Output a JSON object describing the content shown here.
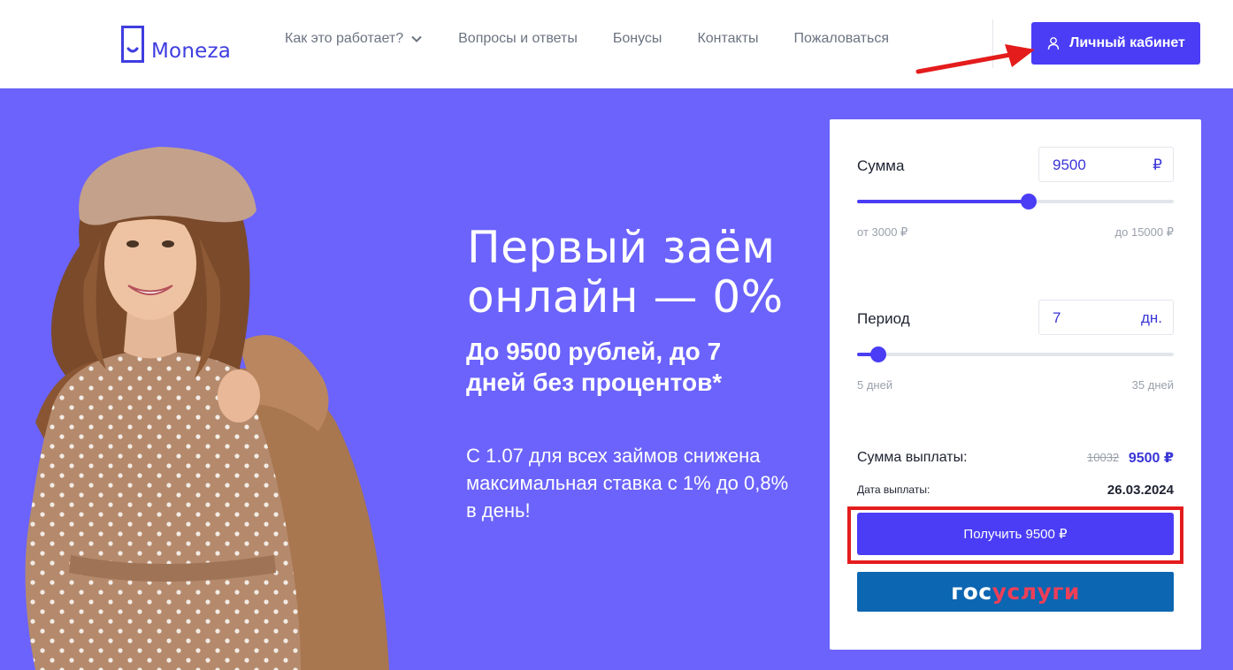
{
  "header": {
    "logo_text": "Moneza",
    "nav": [
      {
        "label": "Как это работает?",
        "has_dropdown": true
      },
      {
        "label": "Вопросы и ответы"
      },
      {
        "label": "Бонусы"
      },
      {
        "label": "Контакты"
      },
      {
        "label": "Пожаловаться"
      }
    ],
    "cabinet_label": "Личный кабинет"
  },
  "hero": {
    "title": "Первый заём онлайн — 0%",
    "subtitle": "До 9500 рублей, до 7 дней без процентов*",
    "note": "С 1.07 для всех займов снижена максимальная ставка с 1% до 0,8% в день!"
  },
  "calculator": {
    "amount": {
      "label": "Сумма",
      "value": "9500",
      "unit": "₽",
      "min_label": "от 3000 ₽",
      "max_label": "до 15000 ₽",
      "min": 3000,
      "max": 15000,
      "current": 9500
    },
    "period": {
      "label": "Период",
      "value": "7",
      "unit": "дн.",
      "min_label": "5 дней",
      "max_label": "35 дней",
      "min": 5,
      "max": 35,
      "current": 7
    },
    "payment_label": "Сумма выплаты:",
    "payment_old": "10032",
    "payment_new": "9500 ₽",
    "date_label": "Дата выплаты:",
    "date_value": "26.03.2024",
    "get_button": "Получить 9500 ₽",
    "gosuslugi_part1": "гос",
    "gosuslugi_part2": "услуги"
  },
  "colors": {
    "accent": "#4a3df5",
    "hero_bg": "#6b63fb",
    "gosuslugi_blue": "#0c66b1",
    "gosuslugi_red": "#ee3f58",
    "annotation_red": "#e41c1c"
  }
}
